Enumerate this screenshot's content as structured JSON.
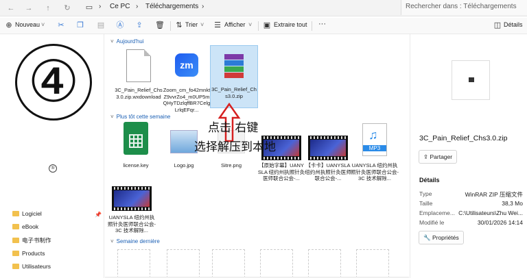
{
  "address_bar": {
    "breadcrumb": [
      "Ce PC",
      "Téléchargements"
    ],
    "search_placeholder": "Rechercher dans : Téléchargements"
  },
  "toolbar": {
    "new_label": "Nouveau",
    "sort_label": "Trier",
    "view_label": "Afficher",
    "extract_label": "Extraire tout",
    "more_label": "···",
    "details_label": "Détails"
  },
  "sidebar": {
    "items": [
      {
        "label": "Logiciel"
      },
      {
        "label": "eBook"
      },
      {
        "label": "电子书制作"
      },
      {
        "label": "Products"
      },
      {
        "label": "Utilisateurs"
      }
    ]
  },
  "annotation": {
    "big_number": "④",
    "small_number": "⑤",
    "line1": "点击 右键",
    "line2": "选择解压到本地",
    "arrow_color": "#d62020"
  },
  "groups": {
    "today": "Aujourd'hui",
    "earlier_week": "Plus tôt cette semaine",
    "last_week": "Semaine dernière"
  },
  "files_today": [
    {
      "label": "3C_Pain_Relief_Chs3.0.zip.wxdownload",
      "icon": "document-icon"
    },
    {
      "label": "Zoom_cm_fo42mnktZ9vvrZo4_m0UP5mQHyTDzlqffBR7CelgLrlqEFqr...",
      "icon": "zoom-icon"
    },
    {
      "label": "3C_Pain_Relief_Chs3.0.zip",
      "icon": "winrar-icon"
    }
  ],
  "files_week": [
    {
      "label": "license.key",
      "icon": "spreadsheet-icon"
    },
    {
      "label": "Logo.jpg",
      "icon": "image-icon"
    },
    {
      "label": "Sitre.png",
      "icon": "image-icon"
    },
    {
      "label": "【原始字幕】UANYSLA 纽约州执照针灸医师联合公会-...",
      "icon": "video-icon"
    },
    {
      "label": "【卡卡】UANYSLA 纽约州执照针灸医师联合公会-...",
      "icon": "video-icon"
    },
    {
      "label": "UANYSLA 纽约州执照针灸医师联合公会-3C 技术解除...",
      "icon": "mp3-icon"
    },
    {
      "label": "UANYSLA 纽约州执照针灸医师联合公会-3C 技术解除...",
      "icon": "video-icon"
    }
  ],
  "details": {
    "filename": "3C_Pain_Relief_Chs3.0.zip",
    "share_label": "Partager",
    "section_title": "Détails",
    "rows": [
      {
        "key": "Type",
        "value": "WinRAR ZIP 压缩文件"
      },
      {
        "key": "Taille",
        "value": "38,3 Mo"
      },
      {
        "key": "Emplaceme...",
        "value": "C:\\Utilisateurs\\Zhu Wei..."
      },
      {
        "key": "Modifié le",
        "value": "30/01/2026 14:14"
      }
    ],
    "properties_label": "Propriétés"
  }
}
